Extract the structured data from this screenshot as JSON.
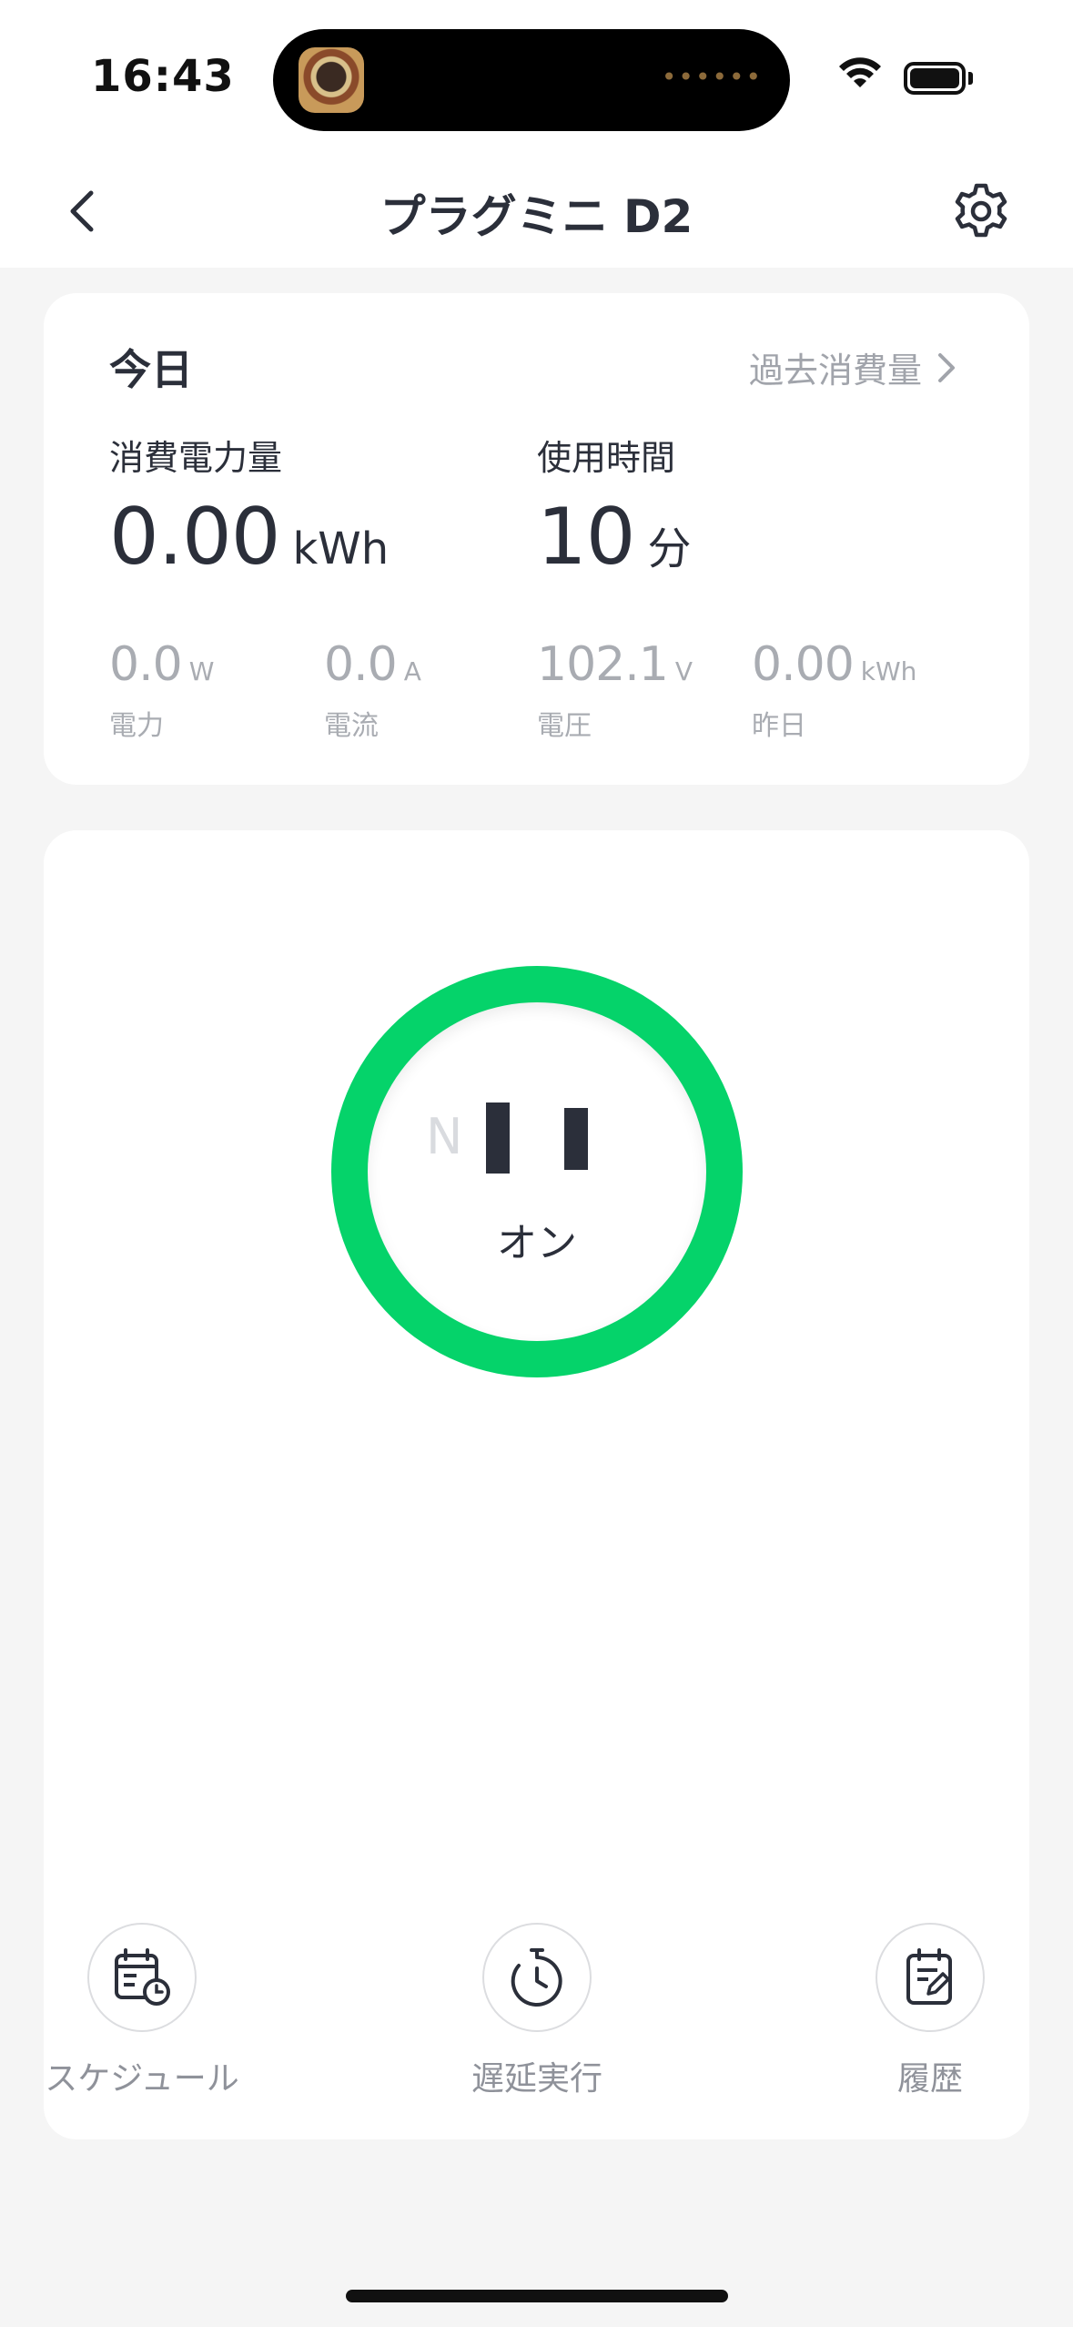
{
  "status_bar": {
    "time": "16:43"
  },
  "nav": {
    "title": "プラグミニ D2",
    "back_icon": "chevron-left-icon",
    "settings_icon": "gear-icon"
  },
  "today_card": {
    "title": "今日",
    "history_link": "過去消費量",
    "energy": {
      "label": "消費電力量",
      "value": "0.00",
      "unit": "kWh"
    },
    "usage_time": {
      "label": "使用時間",
      "value": "10",
      "unit": "分"
    },
    "stats": [
      {
        "value": "0.0",
        "unit": "W",
        "label": "電力"
      },
      {
        "value": "0.0",
        "unit": "A",
        "label": "電流"
      },
      {
        "value": "102.1",
        "unit": "V",
        "label": "電圧"
      },
      {
        "value": "0.00",
        "unit": "kWh",
        "label": "昨日"
      }
    ]
  },
  "power": {
    "socket_letter": "N",
    "state": "オン",
    "ring_color": "#05d36a"
  },
  "actions": [
    {
      "label": "スケジュール",
      "icon": "schedule-calendar-icon"
    },
    {
      "label": "遅延実行",
      "icon": "timer-icon"
    },
    {
      "label": "履歴",
      "icon": "history-notepad-icon"
    }
  ]
}
